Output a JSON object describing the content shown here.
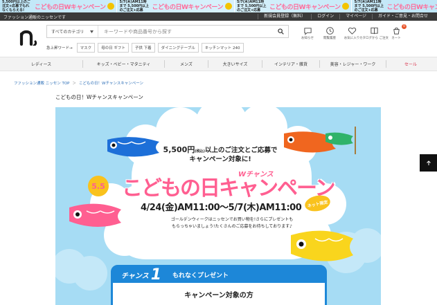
{
  "promo": {
    "units": [
      {
        "small": "5,500円以上のご注文+応募でもれなくもらえる!",
        "title": "こどもの日Wキャンペーン"
      },
      {
        "small": "5/7(木)AM11時まで 5,500円以上のご注文+応募",
        "title": "こどもの日Wキャンペーン"
      },
      {
        "small": "5/7(木)AM11時まで 5,500円以上のご注文+応募",
        "title": "こどもの日Wキャンペーン"
      },
      {
        "small": "5/7(木)AM11時まで 5,500円以上のご注文+応募",
        "title": "こどもの日Wキャンペーン"
      }
    ]
  },
  "topbar": {
    "tagline": "ファッション通販のニッセンです",
    "links": [
      "新規会員登録（無料）",
      "ログイン",
      "マイページ",
      "ガイド・ご意見・お問合せ"
    ]
  },
  "header": {
    "search_category": "すべてのカテゴリ",
    "search_placeholder": "キーワードや商品番号から探す",
    "icons": [
      {
        "name": "chat-icon",
        "label": "お知らせ"
      },
      {
        "name": "history-icon",
        "label": "閲覧履歴"
      },
      {
        "name": "heart-icon",
        "label": "お気に入り"
      },
      {
        "name": "catalog-icon",
        "label": "カタログから ご注文"
      },
      {
        "name": "cart-icon",
        "label": "カート"
      }
    ],
    "cart_count": "0"
  },
  "keywords": {
    "label": "急上昇ワード→",
    "chips": [
      "マスク",
      "母の日 ギフト",
      "子供 下着",
      "ダイニングテーブル",
      "キッチンマット 240"
    ]
  },
  "categories": [
    "レディース",
    "キッズ・ベビー・マタニティ",
    "メンズ",
    "大きいサイズ",
    "インテリア・雑貨",
    "美容・レジャー・ワーク",
    "セール"
  ],
  "breadcrumb": [
    "ファッション通販 ニッセン TOP",
    "＞",
    "こどもの日！Wチャンスキャンペーン"
  ],
  "page_title": "こどもの日！Wチャンスキャンペーン",
  "hero": {
    "cond_line1_a": "5,500円",
    "cond_line1_b": "(税込)",
    "cond_line1_c": "以上のご注文とご応募で",
    "cond_line2": "キャンペーン対象に!",
    "day_badge": "5.5",
    "w_chance": "Wチャンス",
    "title": "こどもの日キャンペーン",
    "period": "4/24(金)AM11:00～5/7(木)AM11:00",
    "net_only": "ネット限定",
    "note_line1": "ゴールデンウィークはニッセンでお買い物を!さらにプレゼントも",
    "note_line2": "もらっちゃいましょう!たくさんのご応募をお待ちしております♪",
    "chance_label": "チャンス",
    "chance_num": "1",
    "chance_sub": "もれなくプレゼント",
    "card_heading": "キャンペーン対象の方"
  },
  "colors": {
    "accent_pink": "#ff5f91",
    "sky": "#a6dcf4",
    "card_blue": "#1d87d8",
    "sale_red": "#d9304a",
    "yellow": "#f9c21d"
  }
}
